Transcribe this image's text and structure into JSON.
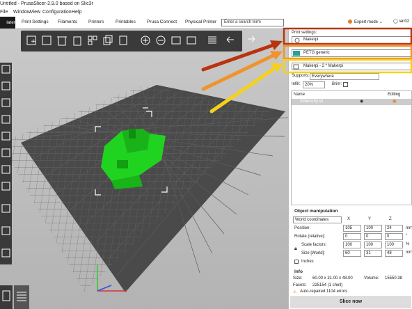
{
  "window": {
    "title": "Untitled - PrusaSlicer-2.9.0 based on Slic3r"
  },
  "menu": [
    "File",
    "Window",
    "View",
    "Configuration",
    "Help"
  ],
  "tabs": {
    "active": "later",
    "items": [
      "Print Settings",
      "Filaments",
      "Printers",
      "Printables",
      "Prusa Connect",
      "Physical Printer"
    ]
  },
  "search": {
    "placeholder": "Enter a search term"
  },
  "mode": {
    "label": "Expert mode"
  },
  "user": {
    "name": "ian02"
  },
  "sidebar": {
    "print_settings_label": "Print settings:",
    "print_profile": "Makerpi",
    "filament_profile": "PETG generic",
    "printer_profile": "Makerpi - 2 * Makerpi",
    "supports_label": "Supports:",
    "supports_value": "Everywhere",
    "infill_label": "Infill:",
    "infill_value": "20%",
    "brim_label": "Brim:",
    "list_header_name": "Name",
    "list_header_editing": "Editing",
    "object_name": "3dbenchy.stl"
  },
  "object_manipulation": {
    "title": "Object manipulation",
    "coords": "World coordinates",
    "axis_x": "X",
    "axis_y": "Y",
    "axis_z": "Z",
    "position_label": "Position:",
    "position": [
      "105",
      "100",
      "24"
    ],
    "position_unit": "mm",
    "rotate_label": "Rotate (relative):",
    "rotate": [
      "0",
      "0",
      "0"
    ],
    "rotate_unit": "°",
    "scale_label": "Scale factors:",
    "scale": [
      "100",
      "100",
      "100"
    ],
    "scale_unit": "%",
    "size_label": "Size [World]:",
    "size": [
      "60",
      "31",
      "48"
    ],
    "size_unit": "mm",
    "inches_label": "Inches"
  },
  "info": {
    "title": "Info",
    "size_label": "Size:",
    "size_value": "60.00 x 31.00 x 48.00",
    "volume_label": "Volume:",
    "volume_value": "15550.38",
    "facets_label": "Facets:",
    "facets_value": "225154 (1 shell)",
    "autorepair": "Auto-repaired 1104 errors"
  },
  "slice_button": "Slice now",
  "colors": {
    "accent": "#e67e22",
    "arrow_red": "#b8340f",
    "arrow_orange": "#f0932b",
    "arrow_yellow": "#f6d11b",
    "model": "#1ed41e",
    "filament_swatch": "#22a39b"
  }
}
